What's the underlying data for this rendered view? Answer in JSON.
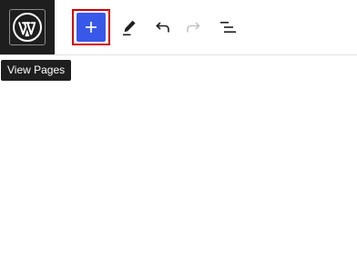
{
  "toolbar": {
    "logo_icon": "wordpress-icon",
    "add_icon": "plus-icon",
    "tools_icon": "pencil-icon",
    "undo_icon": "undo-icon",
    "redo_icon": "redo-icon",
    "list_view_icon": "list-view-icon"
  },
  "tooltip": {
    "text": "View Pages"
  },
  "colors": {
    "accent": "#3858e9",
    "highlight": "#d10000",
    "dark": "#1e1e1e",
    "disabled": "#c4c4c4"
  }
}
